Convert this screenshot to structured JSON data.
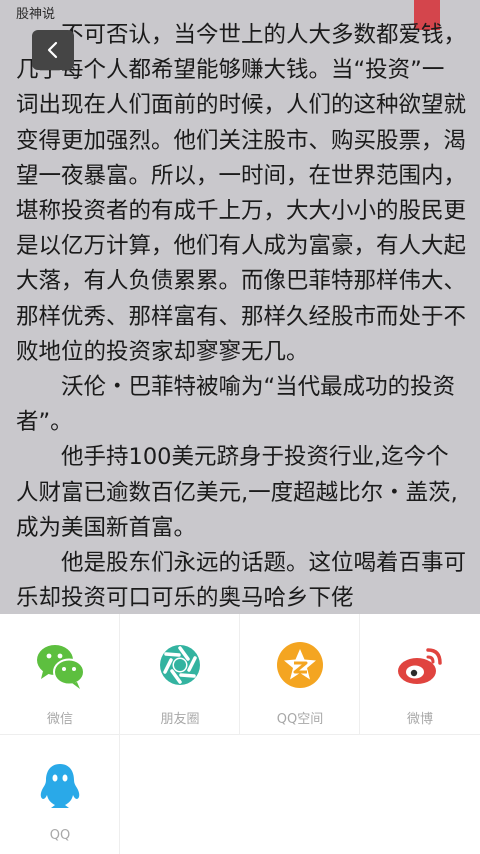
{
  "reader": {
    "book_title": "股神说",
    "paragraphs": [
      "不可否认，当今世上的人大多数都爱钱，几乎每个人都希望能够赚大钱。当“投资”一词出现在人们面前的时候，人们的这种欲望就变得更加强烈。他们关注股市、购买股票，渴望一夜暴富。所以，一时间，在世界范围内，堪称投资者的有成千上万，大大小小的股民更是以亿万计算，他们有人成为富豪，有人大起大落，有人负债累累。而像巴菲特那样伟大、那样优秀、那样富有、那样久经股市而处于不败地位的投资家却寥寥无几。",
      "沃伦・巴菲特被喻为“当代最成功的投资者”。",
      "他手持100美元跻身于投资行业,迄今个人财富已逾数百亿美元,一度超越比尔・盖茨,成为美国新首富。",
      "他是股东们永远的话题。这位喝着百事可乐却投资可口可乐的奥马哈乡下佬"
    ]
  },
  "share": {
    "items": [
      {
        "label": "微信",
        "icon": "wechat-icon"
      },
      {
        "label": "朋友圈",
        "icon": "moments-icon"
      },
      {
        "label": "QQ空间",
        "icon": "qzone-icon"
      },
      {
        "label": "微博",
        "icon": "weibo-icon"
      },
      {
        "label": "QQ",
        "icon": "qq-icon"
      }
    ]
  },
  "colors": {
    "reader_bg": "#c9c8cc",
    "bookmark": "#d4454c",
    "wechat": "#5dbf3f",
    "moments": "#33b3a0",
    "qzone": "#f4a521",
    "weibo": "#e0443f",
    "qq": "#2aa9e8"
  }
}
